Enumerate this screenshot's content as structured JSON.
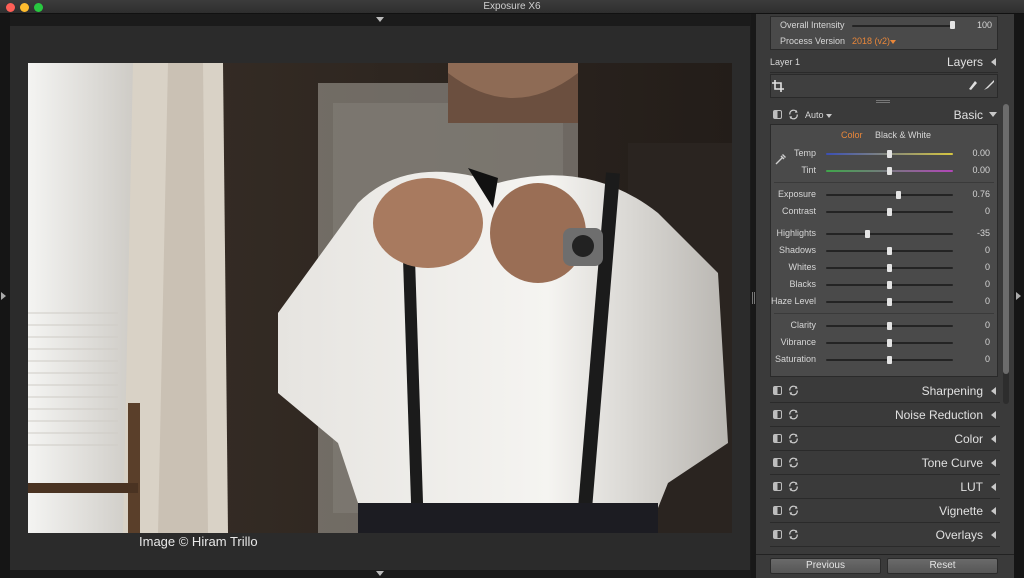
{
  "window": {
    "title": "Exposure X6"
  },
  "photo": {
    "credit": "Image © Hiram Trillo"
  },
  "top_box": {
    "intensity_label": "Overall Intensity",
    "intensity_value": "100",
    "intensity_level": 1.0,
    "process_label": "Process Version",
    "process_value": "2018 (v2)"
  },
  "layers": {
    "layer_name": "Layer 1",
    "title": "Layers"
  },
  "basic": {
    "auto_label": "Auto",
    "title": "Basic",
    "tab_color": "Color",
    "tab_bw": "Black & White",
    "sliders": [
      {
        "label": "Temp",
        "value": "0.00",
        "level": 0.5
      },
      {
        "label": "Tint",
        "value": "0.00",
        "level": 0.5
      },
      {
        "label": "Exposure",
        "value": "0.76",
        "level": 0.57
      },
      {
        "label": "Contrast",
        "value": "0",
        "level": 0.5
      },
      {
        "label": "Highlights",
        "value": "-35",
        "level": 0.33
      },
      {
        "label": "Shadows",
        "value": "0",
        "level": 0.5
      },
      {
        "label": "Whites",
        "value": "0",
        "level": 0.5
      },
      {
        "label": "Blacks",
        "value": "0",
        "level": 0.5
      },
      {
        "label": "Haze Level",
        "value": "0",
        "level": 0.5
      },
      {
        "label": "Clarity",
        "value": "0",
        "level": 0.5
      },
      {
        "label": "Vibrance",
        "value": "0",
        "level": 0.5
      },
      {
        "label": "Saturation",
        "value": "0",
        "level": 0.5
      }
    ]
  },
  "sections": [
    {
      "title": "Sharpening"
    },
    {
      "title": "Noise Reduction"
    },
    {
      "title": "Color"
    },
    {
      "title": "Tone Curve"
    },
    {
      "title": "LUT"
    },
    {
      "title": "Vignette"
    },
    {
      "title": "Overlays"
    }
  ],
  "footer": {
    "previous_label": "Previous",
    "reset_label": "Reset"
  },
  "colors": {
    "accent": "#e9873a",
    "panel": "#3a3a3a",
    "slider_knob": "#e4e4e4"
  }
}
